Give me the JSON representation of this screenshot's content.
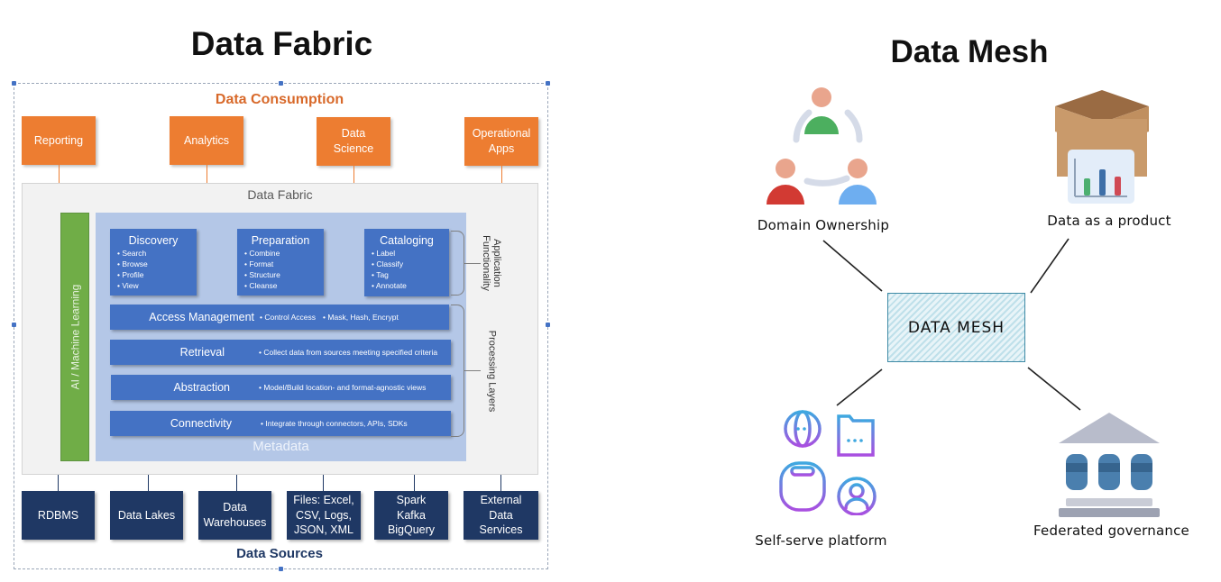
{
  "data_fabric": {
    "title": "Data Fabric",
    "consumption": {
      "title": "Data Consumption",
      "items": [
        "Reporting",
        "Analytics",
        "Data\nScience",
        "Operational\nApps"
      ]
    },
    "panel_title": "Data Fabric",
    "ml_label": "AI / Machine Learning",
    "metadata_label": "Metadata",
    "application_functions": [
      {
        "title": "Discovery",
        "items": [
          "Search",
          "Browse",
          "Profile",
          "View"
        ]
      },
      {
        "title": "Preparation",
        "items": [
          "Combine",
          "Format",
          "Structure",
          "Cleanse"
        ]
      },
      {
        "title": "Cataloging",
        "items": [
          "Label",
          "Classify",
          "Tag",
          "Annotate"
        ]
      }
    ],
    "processing_layers": [
      {
        "name": "Access Management",
        "descriptions": [
          "Control Access",
          "Mask, Hash, Encrypt"
        ]
      },
      {
        "name": "Retrieval",
        "descriptions": [
          "Collect data from sources meeting specified criteria"
        ]
      },
      {
        "name": "Abstraction",
        "descriptions": [
          "Model/Build location- and format-agnostic views"
        ]
      },
      {
        "name": "Connectivity",
        "descriptions": [
          "Integrate through connectors, APIs, SDKs"
        ]
      }
    ],
    "side_labels": {
      "application": "Application\nFunctionality",
      "processing": "Processing Layers"
    },
    "sources": {
      "title": "Data Sources",
      "items": [
        "RDBMS",
        "Data Lakes",
        "Data\nWarehouses",
        "Files: Excel,\nCSV, Logs,\nJSON, XML",
        "Spark\nKafka\nBigQuery",
        "External\nData\nServices"
      ]
    },
    "colors": {
      "consumption": "#ed7d31",
      "function_box": "#4472c4",
      "metadata_panel": "#b4c7e7",
      "ml_bar": "#70ad47",
      "sources": "#1f3864"
    }
  },
  "data_mesh": {
    "title": "Data Mesh",
    "center_label": "DATA MESH",
    "principles": [
      {
        "label": "Domain Ownership",
        "icon": "team-icon"
      },
      {
        "label": "Data as a product",
        "icon": "product-box-icon"
      },
      {
        "label": "Self-serve platform",
        "icon": "platform-icon"
      },
      {
        "label": "Federated governance",
        "icon": "governance-icon"
      }
    ],
    "colors": {
      "center_border": "#3e8aa5",
      "center_hatch": "#bfe0ea"
    }
  }
}
